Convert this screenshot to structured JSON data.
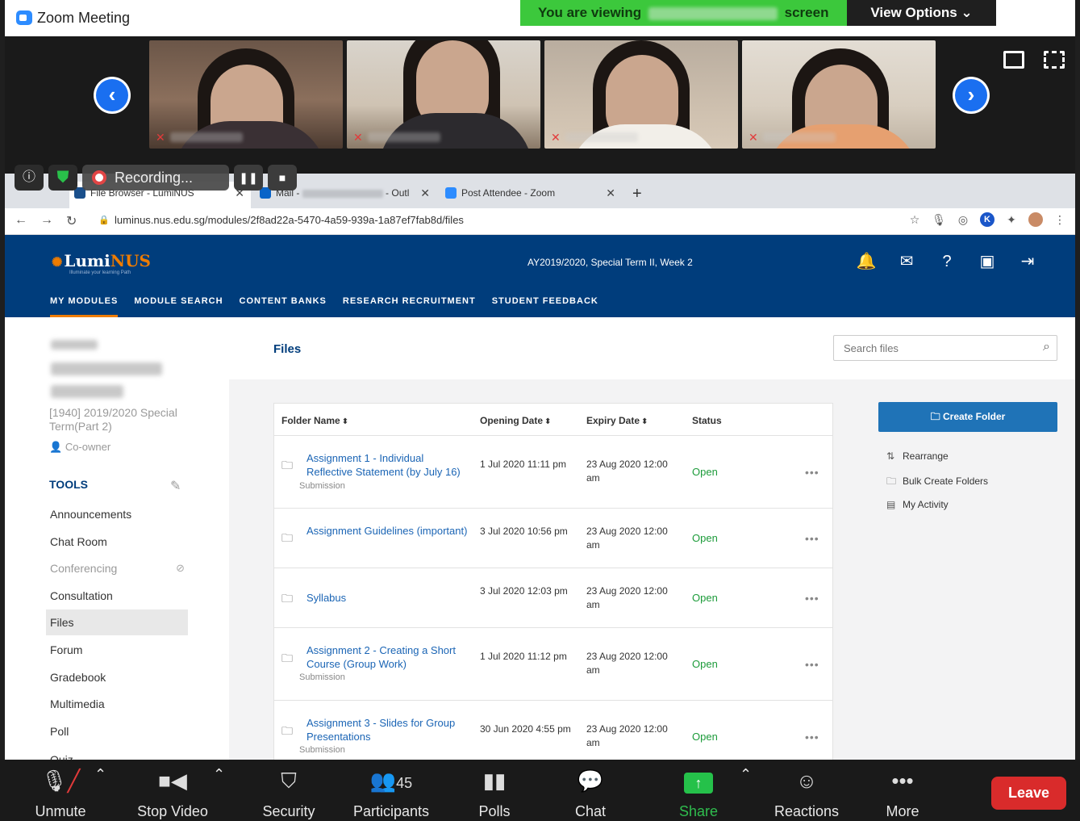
{
  "zoom": {
    "window_title": "Zoom Meeting",
    "banner_prefix": "You are viewing",
    "banner_suffix": "screen",
    "view_options": "View Options ⌄",
    "recording_label": "Recording...",
    "pause_glyph": "❚❚",
    "stop_glyph": "■"
  },
  "browser": {
    "tabs": [
      {
        "label": "File Browser - LumiNUS",
        "active": true
      },
      {
        "label_prefix": "Mail -",
        "label_suffix": "- Outl",
        "active": false
      },
      {
        "label": "Post Attendee - Zoom",
        "active": false
      }
    ],
    "url": "luminus.nus.edu.sg/modules/2f8ad22a-5470-4a59-939a-1a87ef7fab8d/files"
  },
  "luminus": {
    "logo_text_a": "Lumi",
    "logo_text_b": "NUS",
    "logo_tagline": "Illuminate your learning Path",
    "term": "AY2019/2020, Special Term II, Week 2",
    "nav": [
      "MY MODULES",
      "MODULE SEARCH",
      "CONTENT BANKS",
      "RESEARCH RECRUITMENT",
      "STUDENT FEEDBACK"
    ],
    "course_code": "[1940] 2019/2020 Special Term(Part 2)",
    "role": "Co-owner",
    "tools_title": "TOOLS",
    "tools": [
      {
        "label": "Announcements"
      },
      {
        "label": "Chat Room"
      },
      {
        "label": "Conferencing"
      },
      {
        "label": "Consultation"
      },
      {
        "label": "Files"
      },
      {
        "label": "Forum"
      },
      {
        "label": "Gradebook"
      },
      {
        "label": "Multimedia"
      },
      {
        "label": "Poll"
      },
      {
        "label": "Quiz"
      }
    ],
    "page_title": "Files",
    "search_placeholder": "Search files",
    "table": {
      "headers": [
        "Folder Name",
        "Opening Date",
        "Expiry Date",
        "Status"
      ],
      "rows": [
        {
          "name": "Assignment 1 - Individual Reflective Statement (by July 16)",
          "sub": "Submission",
          "opening": "1 Jul 2020 11:11 pm",
          "expiry": "23 Aug 2020 12:00 am",
          "status": "Open"
        },
        {
          "name": "Assignment Guidelines (important)",
          "sub": "",
          "opening": "3 Jul 2020 10:56 pm",
          "expiry": "23 Aug 2020 12:00 am",
          "status": "Open"
        },
        {
          "name": "Syllabus",
          "sub": "",
          "opening": "3 Jul 2020 12:03 pm",
          "expiry": "23 Aug 2020 12:00 am",
          "status": "Open"
        },
        {
          "name": "Assignment 2 - Creating a Short Course (Group Work)",
          "sub": "Submission",
          "opening": "1 Jul 2020 11:12 pm",
          "expiry": "23 Aug 2020 12:00 am",
          "status": "Open"
        },
        {
          "name": "Assignment 3 - Slides for Group Presentations",
          "sub": "Submission",
          "opening": "30 Jun 2020 4:55 pm",
          "expiry": "23 Aug 2020 12:00 am",
          "status": "Open"
        }
      ]
    },
    "create_folder": "Create Folder",
    "side_actions": [
      "Rearrange",
      "Bulk Create Folders",
      "My Activity"
    ]
  },
  "controls": {
    "unmute": "Unmute",
    "stop_video": "Stop Video",
    "security": "Security",
    "participants": "Participants",
    "participants_count": "45",
    "polls": "Polls",
    "chat": "Chat",
    "share_screen": "Share Screen",
    "reactions": "Reactions",
    "more": "More",
    "leave": "Leave"
  },
  "colors": {
    "luminus_blue": "#003d7c",
    "accent_orange": "#ef7c00",
    "status_green": "#1c9b3a",
    "share_green": "#2fbd4e",
    "leave_red": "#d92b2b"
  },
  "icons": [
    "zoom-logo-icon",
    "chevron-left-icon",
    "chevron-right-icon",
    "muted-mic-icon",
    "bell-icon",
    "mail-icon",
    "help-icon",
    "camera-icon",
    "logout-icon",
    "folder-icon",
    "search-icon"
  ]
}
